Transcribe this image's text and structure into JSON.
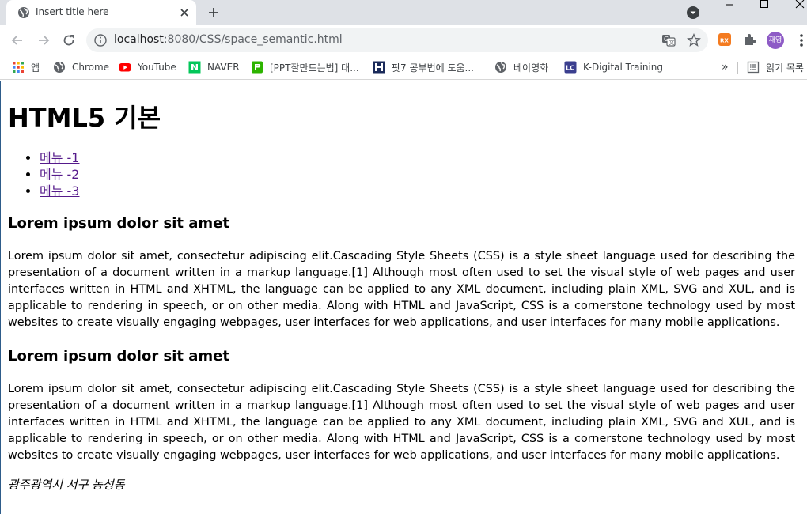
{
  "browser": {
    "tab_title": "Insert title here",
    "url_host": "localhost",
    "url_rest": ":8080/CSS/space_semantic.html",
    "avatar_label": "재영",
    "bookmarks": [
      {
        "label": "앱",
        "icon": "apps-grid-icon"
      },
      {
        "label": "Chrome",
        "icon": "globe-icon"
      },
      {
        "label": "YouTube",
        "icon": "youtube-icon"
      },
      {
        "label": "NAVER",
        "icon": "naver-icon"
      },
      {
        "label": "[PPT잘만드는법] 대...",
        "icon": "ppt-icon"
      },
      {
        "label": "팟7 공부법에 도움...",
        "icon": "h-icon"
      },
      {
        "label": "베이영화",
        "icon": "globe-icon"
      },
      {
        "label": "K-Digital Training",
        "icon": "lc-icon"
      }
    ],
    "overflow_chevron": "»",
    "reading_list": "읽기 목록"
  },
  "page": {
    "heading": "HTML5 기본",
    "menu": [
      "메뉴 -1",
      "메뉴 -2",
      "메뉴 -3"
    ],
    "sections": [
      {
        "title": "Lorem ipsum dolor sit amet",
        "body": "Lorem ipsum dolor sit amet, consectetur adipiscing elit.Cascading Style Sheets (CSS) is a style sheet language used for describing the presentation of a document written in a markup language.[1] Although most often used to set the visual style of web pages and user interfaces written in HTML and XHTML, the language can be applied to any XML document, including plain XML, SVG and XUL, and is applicable to rendering in speech, or on other media. Along with HTML and JavaScript, CSS is a cornerstone technology used by most websites to create visually engaging webpages, user interfaces for web applications, and user interfaces for many mobile applications."
      },
      {
        "title": "Lorem ipsum dolor sit amet",
        "body": "Lorem ipsum dolor sit amet, consectetur adipiscing elit.Cascading Style Sheets (CSS) is a style sheet language used for describing the presentation of a document written in a markup language.[1] Although most often used to set the visual style of web pages and user interfaces written in HTML and XHTML, the language can be applied to any XML document, including plain XML, SVG and XUL, and is applicable to rendering in speech, or on other media. Along with HTML and JavaScript, CSS is a cornerstone technology used by most websites to create visually engaging webpages, user interfaces for web applications, and user interfaces for many mobile applications."
      }
    ],
    "address": "광주광역시 서구 농성동"
  },
  "colors": {
    "tabstrip": "#dee1e6",
    "link_visited": "#551a8b",
    "youtube": "#ff0000",
    "naver": "#03c75a",
    "avatar": "#8e5bc6"
  }
}
